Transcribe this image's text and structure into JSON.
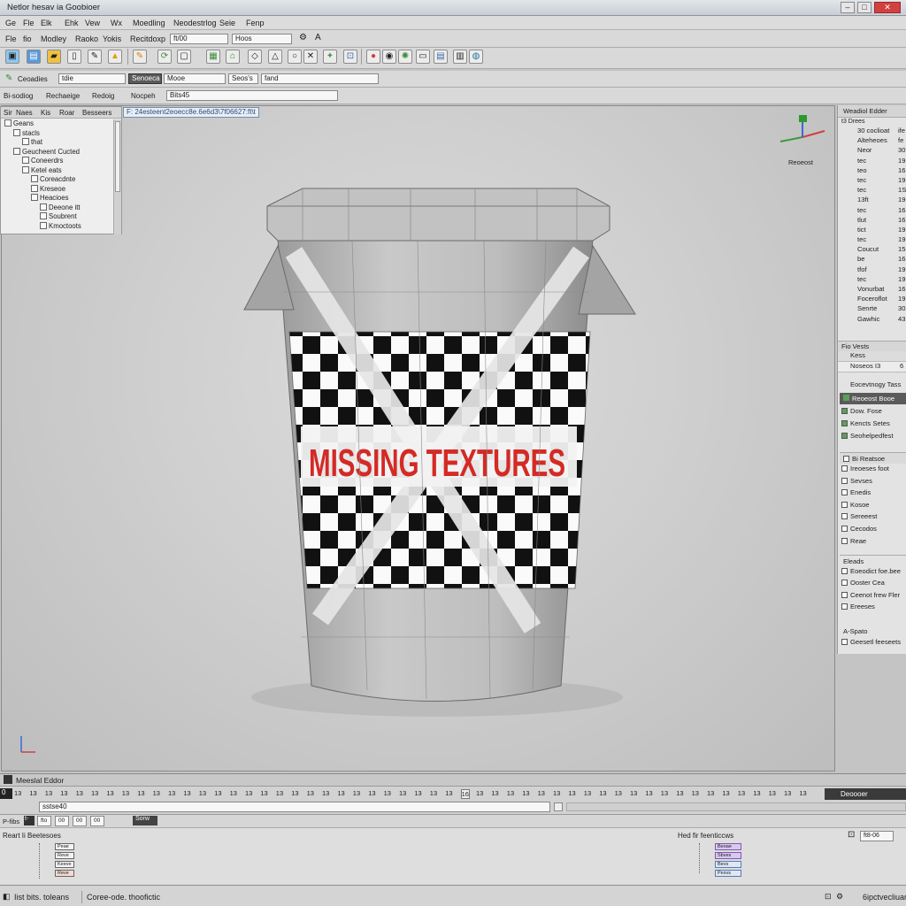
{
  "window": {
    "title": "Netlor hesav ia Goobioer",
    "btn_min": "–",
    "btn_max": "□",
    "btn_close": "✕"
  },
  "menu": [
    "Ge",
    "Fle",
    "Elk",
    "Ehk",
    "Vew",
    "Wx",
    "Moedling",
    "Neodestrlog",
    "Seie",
    "Fenp"
  ],
  "toolbar1": {
    "items": [
      "Fle",
      "fio",
      "Modley",
      "Raoko",
      "Yokis",
      "Recitdoxp"
    ],
    "field1": "ft/00",
    "field2": "Hoos"
  },
  "toolbar3": {
    "label1": "Ceoadies",
    "field1": "tdie",
    "btn1": "Senoeca",
    "btn2": "Mooe",
    "field2": "Seos's",
    "field3": "fand"
  },
  "toolbar4": {
    "items": [
      "Bi-sodiog",
      "Rechaeige",
      "Redoig",
      "Nocpeh"
    ],
    "field": "Bits45"
  },
  "outliner": {
    "headers": [
      "Sir",
      "Naes",
      "Kis",
      "Roar",
      "Besseers"
    ],
    "rows": [
      {
        "indent": 0,
        "label": "Geans"
      },
      {
        "indent": 1,
        "label": "stacls"
      },
      {
        "indent": 2,
        "label": "that"
      },
      {
        "indent": 1,
        "label": "Geucheent Cucted"
      },
      {
        "indent": 2,
        "label": "Coneerdrs"
      },
      {
        "indent": 2,
        "label": "Ketel eats"
      },
      {
        "indent": 3,
        "label": "Coreacdnte"
      },
      {
        "indent": 3,
        "label": "Kreseoe"
      },
      {
        "indent": 3,
        "label": "Heacioes"
      },
      {
        "indent": 4,
        "label": "Deeone itt"
      },
      {
        "indent": 4,
        "label": "Soubrent"
      },
      {
        "indent": 4,
        "label": "Kmoctoots"
      }
    ]
  },
  "viewport": {
    "path": "F: 24esteent2eoecc8e.6e6d3\\7f06627:ft\\t",
    "texture_text": "MISSING TEXTURES",
    "gizmo_label": "Reoeost"
  },
  "right_panel": {
    "title": "Weadiol Edder",
    "subtitle": "t3 Drees",
    "props": [
      {
        "name": "30 coclioat",
        "val": "ife"
      },
      {
        "name": "Alteheoes",
        "val": "fe"
      },
      {
        "name": "Neor",
        "val": "30"
      },
      {
        "name": "tec",
        "val": "19"
      },
      {
        "name": "teo",
        "val": "16"
      },
      {
        "name": "tec",
        "val": "19"
      },
      {
        "name": "tec",
        "val": "1S"
      },
      {
        "name": "13ft",
        "val": "19"
      },
      {
        "name": "tec",
        "val": "16"
      },
      {
        "name": "tlut",
        "val": "16"
      },
      {
        "name": "tict",
        "val": "19"
      },
      {
        "name": "tec",
        "val": "19"
      },
      {
        "name": "Coucut",
        "val": "15"
      },
      {
        "name": "be",
        "val": "16"
      },
      {
        "name": "tfof",
        "val": "19"
      },
      {
        "name": "tec",
        "val": "19"
      },
      {
        "name": "Vonurbat",
        "val": "16"
      },
      {
        "name": "Foceroflot",
        "val": "19"
      },
      {
        "name": "Senrte",
        "val": "30"
      },
      {
        "name": "Gawhic",
        "val": "43"
      }
    ],
    "sec_views": "Fio Vests",
    "views_rows": [
      {
        "name": "Kess",
        "val": ""
      },
      {
        "name": "Noseos I3",
        "val": "6"
      }
    ],
    "sec2_title": "Eocevtnogy Tass",
    "selected": "Reoeost Booe",
    "checks": [
      {
        "label": "Dow. Fose",
        "on": true
      },
      {
        "label": "Kencts Setes",
        "on": true
      },
      {
        "label": "Seohelpedfest",
        "on": true
      }
    ],
    "sec3_title": "Bi Reatsoe",
    "list3": [
      "Ireoeses foot",
      "Sevses",
      "Enedis",
      "Kosoe",
      "Sereeest",
      "Cecodos",
      "Reae"
    ],
    "sec4_title": "Eleads",
    "list4": [
      "Eoeodict foe.bee",
      "Ooster Cea",
      "Ceenot frew Fler",
      "Ereeses"
    ],
    "sec5_title": "A-Spato",
    "list5": [
      "Geesetl feeseets"
    ]
  },
  "timeline": {
    "title": "Meeslal Eddor",
    "numbers": [
      "13",
      "13",
      "13",
      "13",
      "13",
      "13",
      "13",
      "13",
      "13",
      "13",
      "13",
      "13",
      "13",
      "13",
      "13",
      "13",
      "13",
      "13",
      "13",
      "13",
      "13",
      "13",
      "13",
      "13",
      "13",
      "13",
      "13",
      "13",
      "13",
      "16",
      "13",
      "13",
      "13",
      "13",
      "13",
      "13",
      "13",
      "13",
      "13",
      "13",
      "13",
      "13",
      "13",
      "13",
      "13",
      "13",
      "13",
      "13",
      "13",
      "13",
      "13",
      "13"
    ],
    "right_label": "Deoooer",
    "field": "sstse40"
  },
  "bottom": {
    "toolbar": [
      "P-fibs",
      "t-",
      "fto",
      "00",
      "00",
      "00",
      "Sorw"
    ],
    "left_header": "Reart  Ii   Beetesoes",
    "right_header": "Hed fir feenticcws",
    "right_field": "ft8-06",
    "nodes_left": [
      "Peae",
      "Reve",
      "Keeve",
      "Reve"
    ],
    "nodes_right": [
      "Beoae",
      "Sbves",
      "Bevs",
      "Pesvs"
    ]
  },
  "status": {
    "left": "Iist bits. toleans",
    "mid": "Coree-ode. thoofictic",
    "right": "6ipctvecliuar"
  },
  "colors": {
    "missing_text": "#d42a25",
    "accent": "#2b6cb0"
  }
}
